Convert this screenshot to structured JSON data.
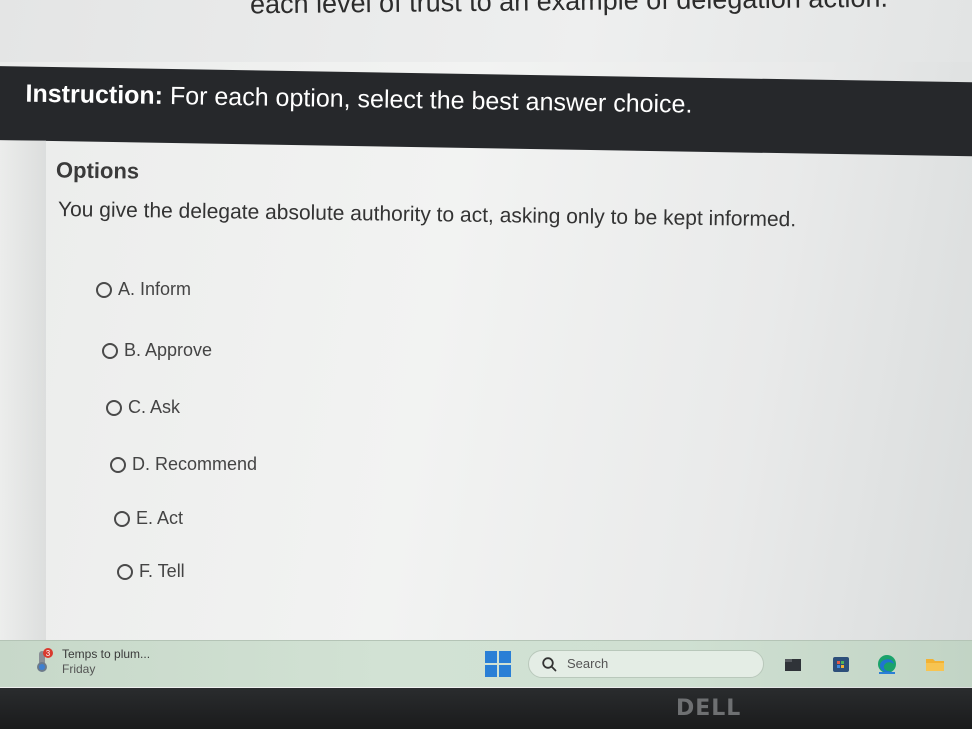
{
  "header_fragment": "each level of trust to an example of delegation action.",
  "instruction": {
    "label": "Instruction:",
    "text": " For each option, select the best answer choice."
  },
  "options": {
    "heading": "Options",
    "statement": "You give the delegate absolute authority to act, asking only to be kept informed."
  },
  "answers": [
    {
      "label": "A. Inform"
    },
    {
      "label": "B. Approve"
    },
    {
      "label": "C. Ask"
    },
    {
      "label": "D. Recommend"
    },
    {
      "label": "E. Act"
    },
    {
      "label": "F. Tell"
    }
  ],
  "taskbar": {
    "weather_title": "Temps to plum...",
    "weather_sub": "Friday",
    "weather_badge": "3",
    "search_placeholder": "Search",
    "icons": [
      "weather-icon",
      "windows-start-icon",
      "search-icon",
      "file-explorer-icon",
      "store-icon",
      "edge-icon",
      "folder-icon"
    ],
    "accent_color": "#2a7fd6"
  },
  "bezel": {
    "brand": "DELL"
  }
}
